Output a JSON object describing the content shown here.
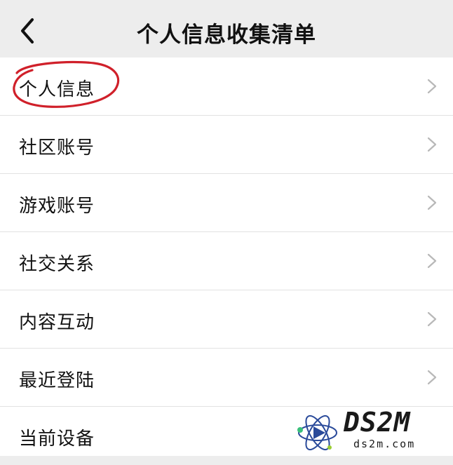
{
  "header": {
    "title": "个人信息收集清单",
    "back_icon": "chevron-left-icon"
  },
  "list": {
    "items": [
      {
        "label": "个人信息",
        "icon": "chevron-right-icon"
      },
      {
        "label": "社区账号",
        "icon": "chevron-right-icon"
      },
      {
        "label": "游戏账号",
        "icon": "chevron-right-icon"
      },
      {
        "label": "社交关系",
        "icon": "chevron-right-icon"
      },
      {
        "label": "内容互动",
        "icon": "chevron-right-icon"
      },
      {
        "label": "最近登陆",
        "icon": "chevron-right-icon"
      },
      {
        "label": "当前设备",
        "icon": "chevron-right-icon"
      }
    ]
  },
  "watermark": {
    "text": "DS2M",
    "subtext": "ds2m.com"
  },
  "colors": {
    "background": "#ededed",
    "annotation": "#d0202a",
    "chevron": "#b8b8b8"
  }
}
